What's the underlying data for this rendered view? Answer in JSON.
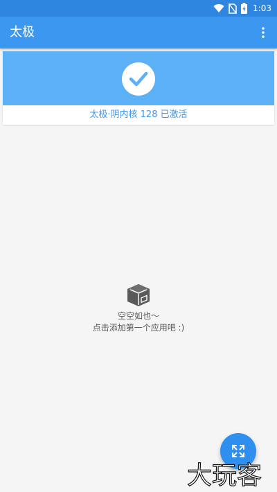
{
  "status_bar": {
    "time": "1:03"
  },
  "app_bar": {
    "title": "太极",
    "overflow_icon": "more-vert-icon"
  },
  "status_card": {
    "icon": "check-icon",
    "activation_text": "太极·阴内核 128 已激活",
    "banner_color": "#5cb0f6",
    "text_color": "#3b97ef"
  },
  "empty_state": {
    "icon": "box-icon",
    "line1": "空空如也～",
    "line2": "点击添加第一个应用吧 :)"
  },
  "fab": {
    "icon": "expand-icon"
  },
  "watermark": {
    "text": "大玩客"
  },
  "colors": {
    "primary": "#3b97ef",
    "primary_dark": "#2f86e0",
    "background": "#f5f5f5"
  }
}
